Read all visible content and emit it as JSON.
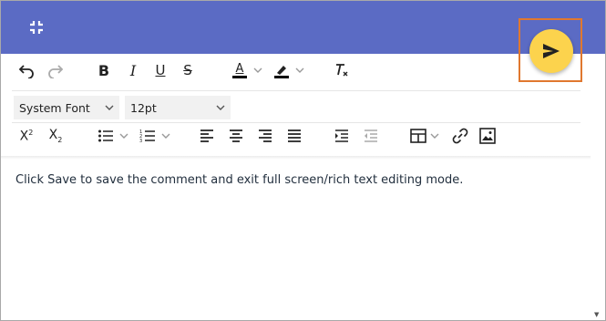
{
  "header": {
    "exit_fullscreen_icon": "exit-fullscreen-icon",
    "send_icon": "send-icon",
    "bg": "#5b6bc4",
    "accent": "#fcd34d"
  },
  "toolbar": {
    "font_family": "System Font",
    "font_size": "12pt",
    "text_color_letter": "A"
  },
  "editor": {
    "content": "Click Save to save the comment and exit full screen/rich text editing mode."
  }
}
